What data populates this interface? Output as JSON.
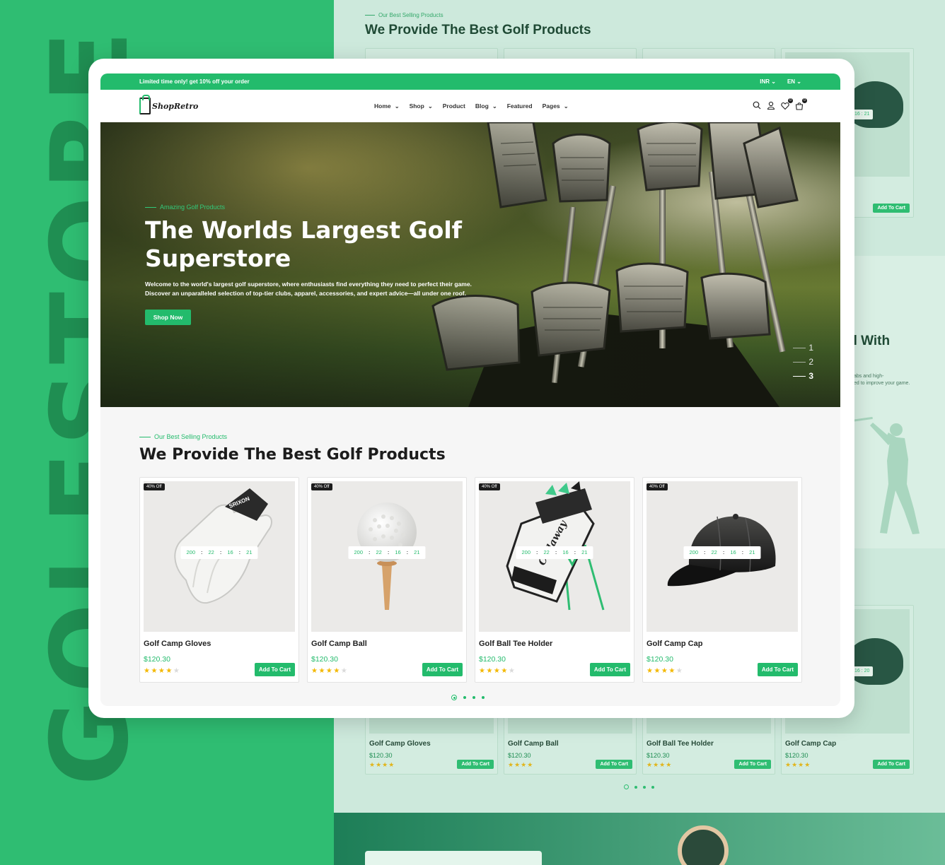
{
  "watermark": {
    "text": "GOLFSTORE"
  },
  "background": {
    "eyebrow": "Our Best Selling Products",
    "title": "We Provide The Best Golf Products",
    "partial_heading": "el With",
    "partial_text_1": "abs and high-",
    "partial_text_2": "ed to improve your game.",
    "cards_top": [
      {
        "button": "Add To Cart",
        "timer": "16 : 21"
      }
    ],
    "cards_bottom": [
      {
        "name": "Golf Camp Gloves",
        "price": "$120.30",
        "stars": "★★★★",
        "button": "Add To Cart"
      },
      {
        "name": "Golf Camp Ball",
        "price": "$120.30",
        "stars": "★★★★",
        "button": "Add To Cart"
      },
      {
        "name": "Golf Ball Tee Holder",
        "price": "$120.30",
        "stars": "★★★★",
        "button": "Add To Cart"
      },
      {
        "name": "Golf Camp Cap",
        "price": "$120.30",
        "stars": "★★★★",
        "button": "Add To Cart",
        "timer": "16 : 20"
      }
    ]
  },
  "topbar": {
    "promo": "Limited time only! get 10% off your order",
    "currency": "INR",
    "language": "EN"
  },
  "nav": {
    "logo": "ShopRetro",
    "menu": [
      "Home",
      "Shop",
      "Product",
      "Blog",
      "Featured",
      "Pages"
    ],
    "wishlist_count": "0",
    "cart_count": "0",
    "icons": [
      "search-icon",
      "user-icon",
      "heart-icon",
      "cart-icon"
    ]
  },
  "hero": {
    "eyebrow": "Amazing Golf Products",
    "title": "The Worlds Largest Golf Superstore",
    "text": "Welcome to the world's largest golf superstore, where enthusiasts find everything they need to perfect their game. Discover an unparalleled selection of top-tier clubs, apparel, accessories, and expert advice—all under one roof.",
    "button": "Shop Now",
    "slides": [
      "1",
      "2",
      "3"
    ],
    "active_slide": 3
  },
  "products": {
    "eyebrow": "Our Best Selling Products",
    "title": "We Provide The Best Golf Products",
    "items": [
      {
        "badge": "40% Off",
        "name": "Golf Camp Gloves",
        "price": "$120.30",
        "rating": 4,
        "timer": [
          "200",
          "22",
          "16",
          "21"
        ],
        "button": "Add To Cart",
        "image": "glove"
      },
      {
        "badge": "40% Off",
        "name": "Golf Camp Ball",
        "price": "$120.30",
        "rating": 4,
        "timer": [
          "200",
          "22",
          "16",
          "21"
        ],
        "button": "Add To Cart",
        "image": "ball"
      },
      {
        "badge": "40% Off",
        "name": "Golf Ball Tee Holder",
        "price": "$120.30",
        "rating": 4,
        "timer": [
          "200",
          "22",
          "16",
          "21"
        ],
        "button": "Add To Cart",
        "image": "bag"
      },
      {
        "badge": "40% Off",
        "name": "Golf Camp Cap",
        "price": "$120.30",
        "rating": 4,
        "timer": [
          "200",
          "22",
          "16",
          "21"
        ],
        "button": "Add To Cart",
        "image": "cap"
      }
    ],
    "pager_count": 4,
    "pager_active": 1
  },
  "colors": {
    "brand": "#23bb6c",
    "outer_background": "#2fbd72",
    "watermark": "#1f8e52",
    "showcase_background": "#cde9dc",
    "star": "#f3b800"
  }
}
